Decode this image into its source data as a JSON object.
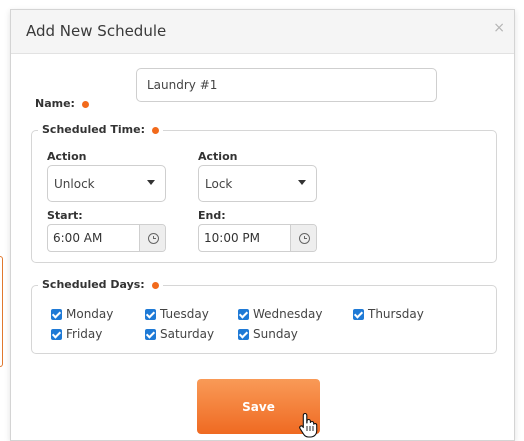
{
  "dialog": {
    "title": "Add New Schedule",
    "close_icon": "×"
  },
  "name": {
    "label": "Name:",
    "value": "Laundry #1"
  },
  "scheduled_time": {
    "legend": "Scheduled Time:",
    "start_action": {
      "label": "Action",
      "value": "Unlock"
    },
    "end_action": {
      "label": "Action",
      "value": "Lock"
    },
    "start": {
      "label": "Start:",
      "value": "6:00 AM"
    },
    "end": {
      "label": "End:",
      "value": "10:00 PM"
    }
  },
  "scheduled_days": {
    "legend": "Scheduled Days:",
    "days": [
      {
        "label": "Monday",
        "checked": true
      },
      {
        "label": "Tuesday",
        "checked": true
      },
      {
        "label": "Wednesday",
        "checked": true
      },
      {
        "label": "Thursday",
        "checked": true
      },
      {
        "label": "Friday",
        "checked": true
      },
      {
        "label": "Saturday",
        "checked": true
      },
      {
        "label": "Sunday",
        "checked": true
      }
    ]
  },
  "actions": {
    "save_label": "Save"
  },
  "colors": {
    "accent": "#ef6a22",
    "required_dot": "#f26a1b",
    "checkbox": "#1f7ad6"
  },
  "icons": [
    "close-icon",
    "required-dot-icon",
    "dropdown-caret-icon",
    "clock-icon",
    "checkbox-checked-icon",
    "hand-pointer-icon"
  ]
}
